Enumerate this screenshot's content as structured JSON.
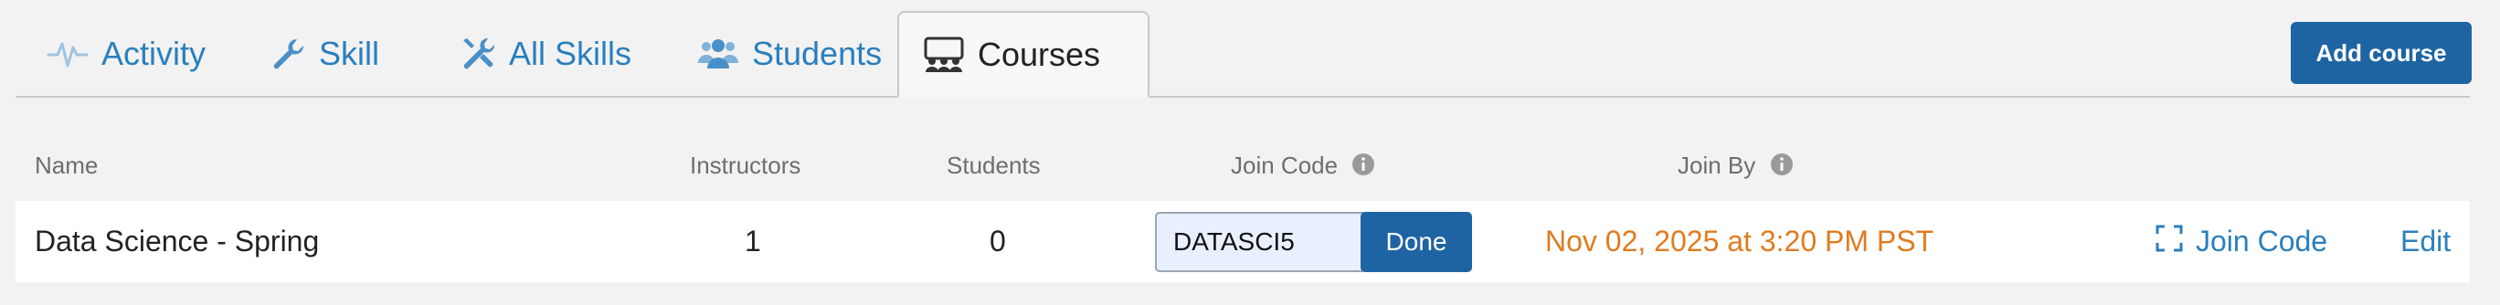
{
  "tabs": [
    {
      "label": "Activity",
      "icon": "activity-icon"
    },
    {
      "label": "Skill",
      "icon": "wrench-icon"
    },
    {
      "label": "All Skills",
      "icon": "tools-icon"
    },
    {
      "label": "Students",
      "icon": "users-icon"
    },
    {
      "label": "Courses",
      "icon": "classroom-icon",
      "active": true
    }
  ],
  "add_course_label": "Add course",
  "table": {
    "columns": {
      "name": "Name",
      "instructors": "Instructors",
      "students": "Students",
      "join_code": "Join Code",
      "join_by": "Join By"
    },
    "rows": [
      {
        "name": "Data Science - Spring",
        "instructors": "1",
        "students": "0",
        "join_code_value": "DATASCI5",
        "done_label": "Done",
        "join_by": "Nov 02, 2025 at 3:20 PM PST",
        "join_code_link": "Join Code",
        "edit_link": "Edit"
      }
    ]
  },
  "colors": {
    "accent": "#2a7fbd",
    "button": "#1e64a3",
    "join_by": "#e07b1f",
    "background": "#f2f2f2"
  }
}
